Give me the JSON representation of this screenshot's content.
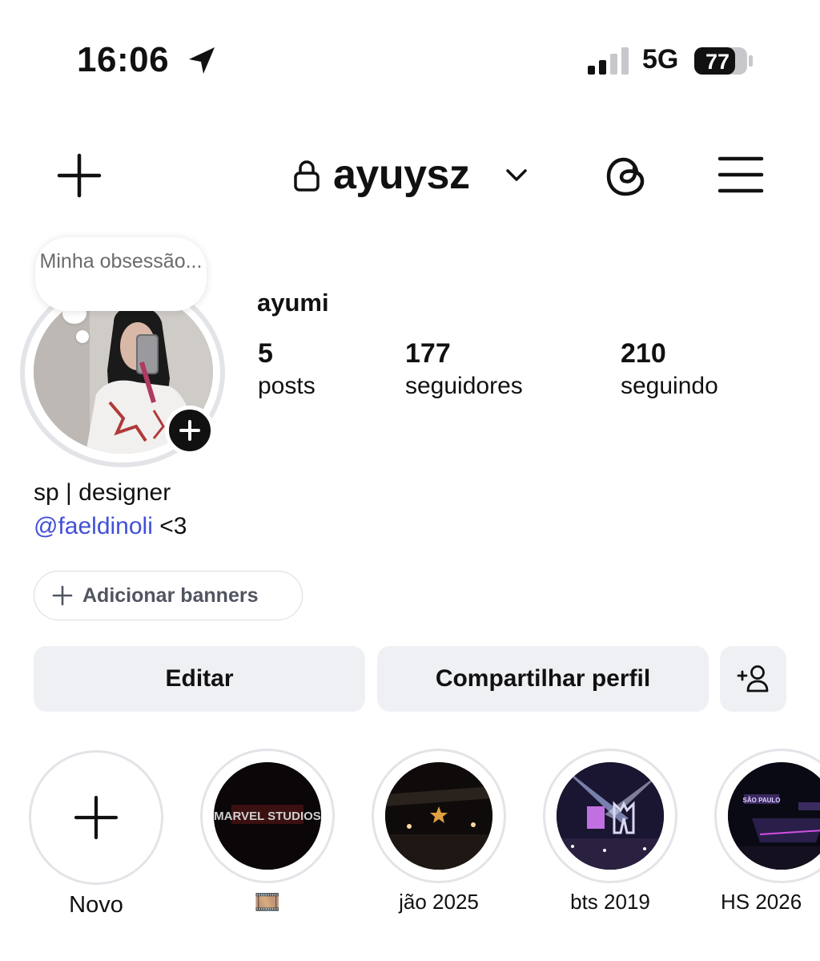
{
  "status_bar": {
    "time": "16:06",
    "network": "5G",
    "battery": "77"
  },
  "header": {
    "username": "ayuysz"
  },
  "profile": {
    "note": "Minha obsessão...",
    "display_name": "ayumi",
    "stats": [
      {
        "value": "5",
        "label": "posts"
      },
      {
        "value": "177",
        "label": "seguidores"
      },
      {
        "value": "210",
        "label": "seguindo"
      }
    ],
    "bio": {
      "line1": "sp | designer",
      "mention": "@faeldinoli",
      "line2_suffix": " <3"
    }
  },
  "actions": {
    "add_banners": "Adicionar banners",
    "edit": "Editar",
    "share": "Compartilhar perfil"
  },
  "highlights": [
    {
      "label": "Novo"
    },
    {
      "label": "🎞️",
      "caption": "MARVEL STUDIOS"
    },
    {
      "label": "jão 2025"
    },
    {
      "label": "bts 2019"
    },
    {
      "label": "HS 2026",
      "caption": "SÃO PAULO"
    }
  ],
  "colors": {
    "mention": "#4150d8",
    "button_bg": "#eff0f4",
    "ring": "#e3e4e8"
  }
}
